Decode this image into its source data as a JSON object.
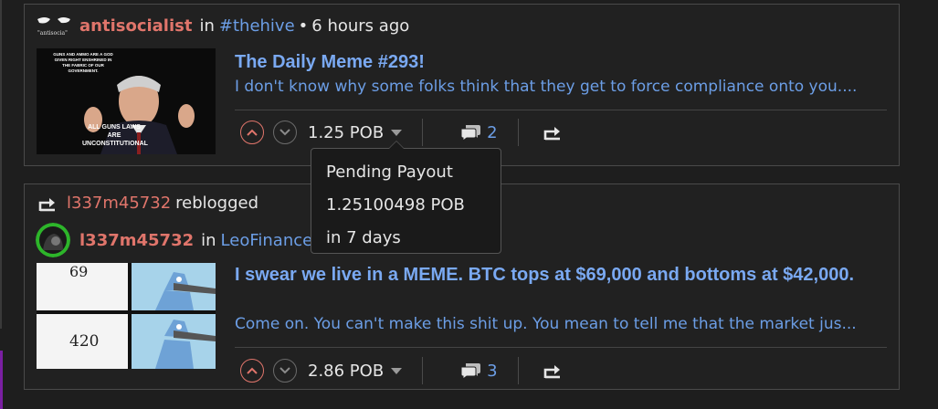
{
  "posts": [
    {
      "author": "antisocialist",
      "in_word": "in",
      "community": "#thehive",
      "time": "6 hours ago",
      "avatar_text": "\"antisocia\"",
      "thumb_text_top": "GUNS AND AMMO ARE A GOD GIVEN RIGHT ENSHRINED IN THE FABRIC OF OUR GOVERNMENT.",
      "thumb_text_bottom": "ALL GUNS LAWS ARE UNCONSTITUTIONAL",
      "title": "The Daily Meme #293!",
      "description": "I don't know why some folks think that they get to force compliance onto you....",
      "payout": "1.25 POB",
      "comments": "2"
    },
    {
      "reblogged_by": "l337m45732",
      "reblogged_word": "reblogged",
      "author": "l337m45732",
      "in_word": "in",
      "community": "LeoFinance",
      "thumb_num_top": "69",
      "thumb_num_bottom": "420",
      "title": "I swear we live in a MEME. BTC tops at $69,000 and bottoms at $42,000.",
      "description": "Come on. You can't make this shit up. You mean to tell me that the market jus...",
      "payout": "2.86 POB",
      "comments": "3"
    }
  ],
  "tooltip": {
    "line1": "Pending Payout",
    "line2": "1.25100498 POB",
    "line3": "in 7 days"
  },
  "colors": {
    "author": "#e0756b",
    "link": "#6c9ee6",
    "title": "#7aa9f2",
    "background": "#1e1e1e"
  },
  "icons": [
    "chevron-up-icon",
    "chevron-down-icon",
    "caret-down-icon",
    "comment-icon",
    "reblog-icon"
  ]
}
